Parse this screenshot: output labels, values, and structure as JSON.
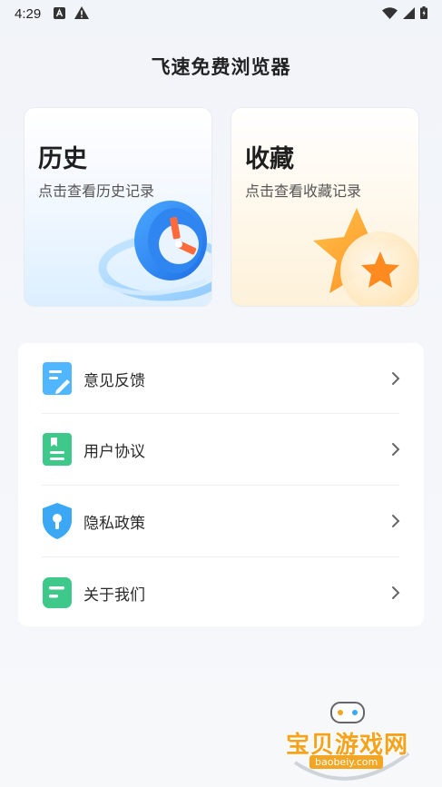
{
  "status_bar": {
    "time": "4:29",
    "icons": [
      "a-icon",
      "warning-icon",
      "wifi-icon",
      "signal-icon",
      "battery-icon"
    ]
  },
  "app": {
    "title": "飞速免费浏览器"
  },
  "cards": {
    "history": {
      "title": "历史",
      "subtitle": "点击查看历史记录",
      "icon": "clock-icon"
    },
    "favorites": {
      "title": "收藏",
      "subtitle": "点击查看收藏记录",
      "icon": "star-icon"
    }
  },
  "menu": {
    "items": [
      {
        "label": "意见反馈",
        "icon": "feedback-icon",
        "color": "#4fb6ff"
      },
      {
        "label": "用户协议",
        "icon": "agreement-icon",
        "color": "#3ec98a"
      },
      {
        "label": "隐私政策",
        "icon": "shield-icon",
        "color": "#3aa8f5"
      },
      {
        "label": "关于我们",
        "icon": "about-icon",
        "color": "#3ec98a"
      }
    ]
  },
  "watermark": {
    "text": "宝贝游戏网",
    "url": "baobeiy.com"
  }
}
